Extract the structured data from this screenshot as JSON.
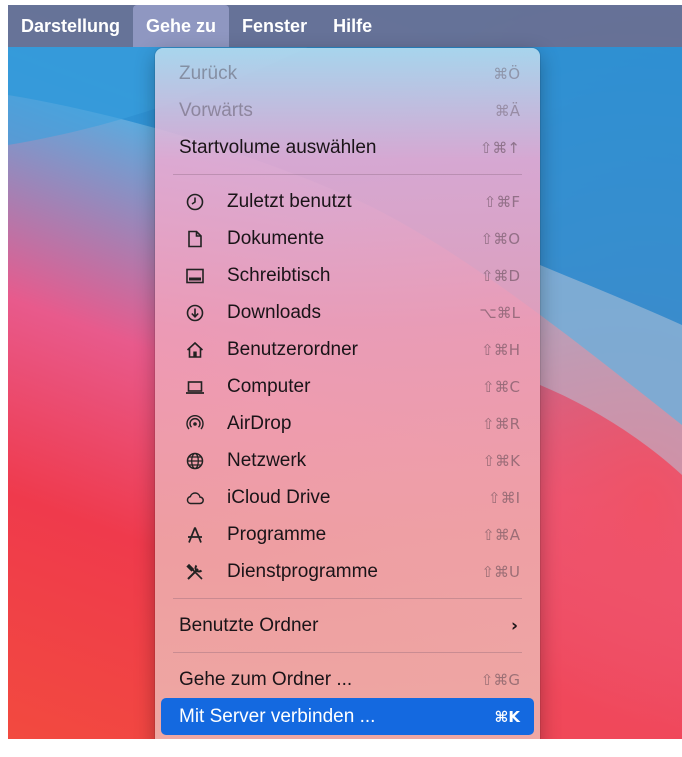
{
  "menubar": {
    "items": [
      "Darstellung",
      "Gehe zu",
      "Fenster",
      "Hilfe"
    ],
    "active": "Gehe zu"
  },
  "menu": {
    "group_top": [
      {
        "label": "Zurück",
        "shortcut": "⌘Ö",
        "disabled": true
      },
      {
        "label": "Vorwärts",
        "shortcut": "⌘Ä",
        "disabled": true
      },
      {
        "label": "Startvolume auswählen",
        "shortcut": "⇧⌘↑",
        "disabled": false
      }
    ],
    "locations": [
      {
        "label": "Zuletzt benutzt",
        "shortcut": "⇧⌘F",
        "icon": "clock-icon"
      },
      {
        "label": "Dokumente",
        "shortcut": "⇧⌘O",
        "icon": "document-icon"
      },
      {
        "label": "Schreibtisch",
        "shortcut": "⇧⌘D",
        "icon": "desktop-icon"
      },
      {
        "label": "Downloads",
        "shortcut": "⌥⌘L",
        "icon": "download-icon"
      },
      {
        "label": "Benutzerordner",
        "shortcut": "⇧⌘H",
        "icon": "home-icon"
      },
      {
        "label": "Computer",
        "shortcut": "⇧⌘C",
        "icon": "laptop-icon"
      },
      {
        "label": "AirDrop",
        "shortcut": "⇧⌘R",
        "icon": "airdrop-icon"
      },
      {
        "label": "Netzwerk",
        "shortcut": "⇧⌘K",
        "icon": "globe-icon"
      },
      {
        "label": "iCloud Drive",
        "shortcut": "⇧⌘I",
        "icon": "cloud-icon"
      },
      {
        "label": "Programme",
        "shortcut": "⇧⌘A",
        "icon": "applications-icon"
      },
      {
        "label": "Dienstprogramme",
        "shortcut": "⇧⌘U",
        "icon": "tools-icon"
      }
    ],
    "recent_folders": {
      "label": "Benutzte Ordner",
      "chevron": "›"
    },
    "goto_folder": {
      "label": "Gehe zum Ordner ...",
      "shortcut": "⇧⌘G"
    },
    "connect_server": {
      "label": "Mit Server verbinden ...",
      "shortcut": "⌘K",
      "selected": true
    }
  },
  "colors": {
    "selection": "#1469e0",
    "menubar": "#696e91"
  }
}
